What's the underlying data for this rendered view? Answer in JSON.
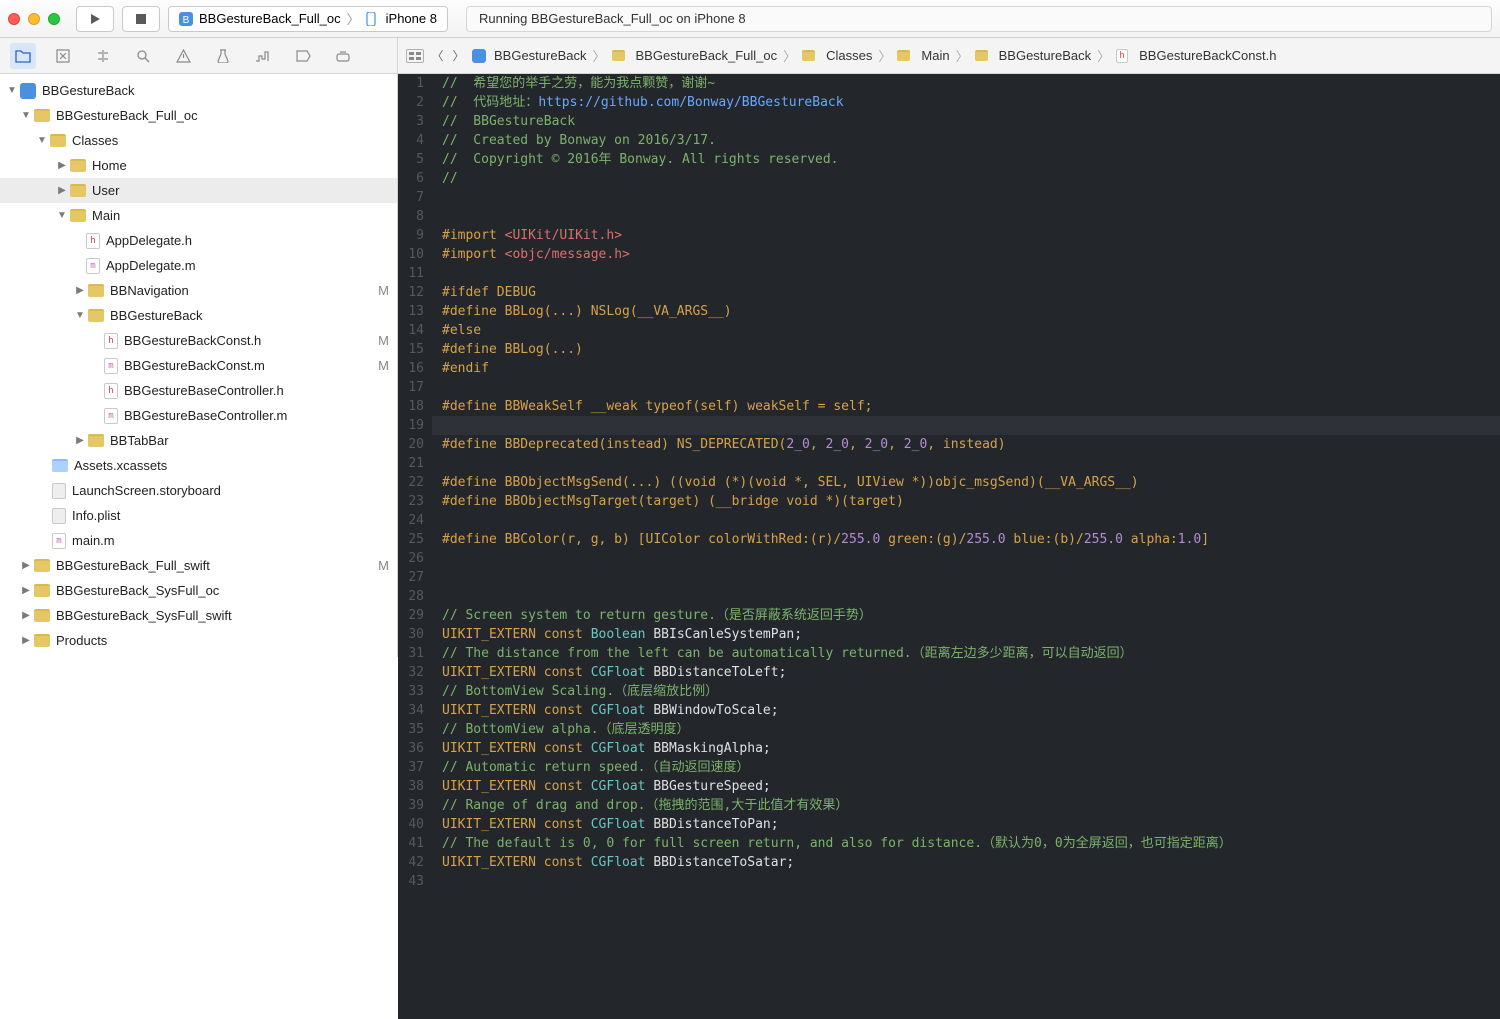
{
  "titlebar": {
    "scheme_project": "BBGestureBack_Full_oc",
    "scheme_device": "iPhone 8",
    "status_text": "Running BBGestureBack_Full_oc on iPhone 8"
  },
  "breadcrumbs": {
    "c0": "BBGestureBack",
    "c1": "BBGestureBack_Full_oc",
    "c2": "Classes",
    "c3": "Main",
    "c4": "BBGestureBack",
    "c5": "BBGestureBackConst.h"
  },
  "tree": {
    "root": "BBGestureBack",
    "n1": "BBGestureBack_Full_oc",
    "n2": "Classes",
    "n3": "Home",
    "n4": "User",
    "n5": "Main",
    "n6": "AppDelegate.h",
    "n7": "AppDelegate.m",
    "n8": "BBNavigation",
    "n9": "BBGestureBack",
    "n10": "BBGestureBackConst.h",
    "n11": "BBGestureBackConst.m",
    "n12": "BBGestureBaseController.h",
    "n13": "BBGestureBaseController.m",
    "n14": "BBTabBar",
    "n15": "Assets.xcassets",
    "n16": "LaunchScreen.storyboard",
    "n17": "Info.plist",
    "n18": "main.m",
    "n19": "BBGestureBack_Full_swift",
    "n20": "BBGestureBack_SysFull_oc",
    "n21": "BBGestureBack_SysFull_swift",
    "n22": "Products",
    "mod": "M"
  },
  "code": {
    "l1": "//  希望您的举手之劳，能为我点颗赞，谢谢~",
    "l2a": "//  代码地址：",
    "l2b": "https://github.com/Bonway/BBGestureBack",
    "l3": "//  BBGestureBack",
    "l4": "//  Created by Bonway on 2016/3/17.",
    "l5": "//  Copyright © 2016年 Bonway. All rights reserved.",
    "l6": "//",
    "l9a": "#import ",
    "l9b": "<UIKit/UIKit.h>",
    "l10a": "#import ",
    "l10b": "<objc/message.h>",
    "l12": "#ifdef DEBUG",
    "l13": "#define BBLog(...) NSLog(__VA_ARGS__)",
    "l14": "#else",
    "l15": "#define BBLog(...)",
    "l16": "#endif",
    "l18": "#define BBWeakSelf __weak typeof(self) weakSelf = self;",
    "l20a": "#define BBDeprecated(instead) NS_DEPRECATED(",
    "l20b": "2_0",
    "l20c": ", ",
    "l20d": "2_0",
    "l20e": ", ",
    "l20f": "2_0",
    "l20g": ", ",
    "l20h": "2_0",
    "l20i": ", instead)",
    "l22": "#define BBObjectMsgSend(...) ((void (*)(void *, SEL, UIView *))objc_msgSend)(__VA_ARGS__)",
    "l23": "#define BBObjectMsgTarget(target) (__bridge void *)(target)",
    "l25a": "#define BBColor(r, g, b) [UIColor colorWithRed:(r)/",
    "l25b": "255.0",
    "l25c": " green:(g)/",
    "l25d": "255.0",
    "l25e": " blue:(b)/",
    "l25f": "255.0",
    "l25g": " alpha:",
    "l25h": "1.0",
    "l25i": "]",
    "l29": "// Screen system to return gesture.（是否屏蔽系统返回手势）",
    "l30a": "UIKIT_EXTERN",
    "l30b": "const",
    "l30c": "Boolean",
    "l30d": "BBIsCanleSystemPan;",
    "l31": "// The distance from the left can be automatically returned.（距离左边多少距离，可以自动返回）",
    "l32c": "CGFloat",
    "l32d": "BBDistanceToLeft;",
    "l33": "// BottomView Scaling.（底层缩放比例）",
    "l34d": "BBWindowToScale;",
    "l35": "// BottomView alpha.（底层透明度）",
    "l36d": "BBMaskingAlpha;",
    "l37": "// Automatic return speed.（自动返回速度）",
    "l38d": "BBGestureSpeed;",
    "l39": "// Range of drag and drop.（拖拽的范围,大于此值才有效果）",
    "l40d": "BBDistanceToPan;",
    "l41": "// The default is 0, 0 for full screen return, and also for distance.（默认为0，0为全屏返回，也可指定距离）",
    "l42d": "BBDistanceToSatar;"
  }
}
